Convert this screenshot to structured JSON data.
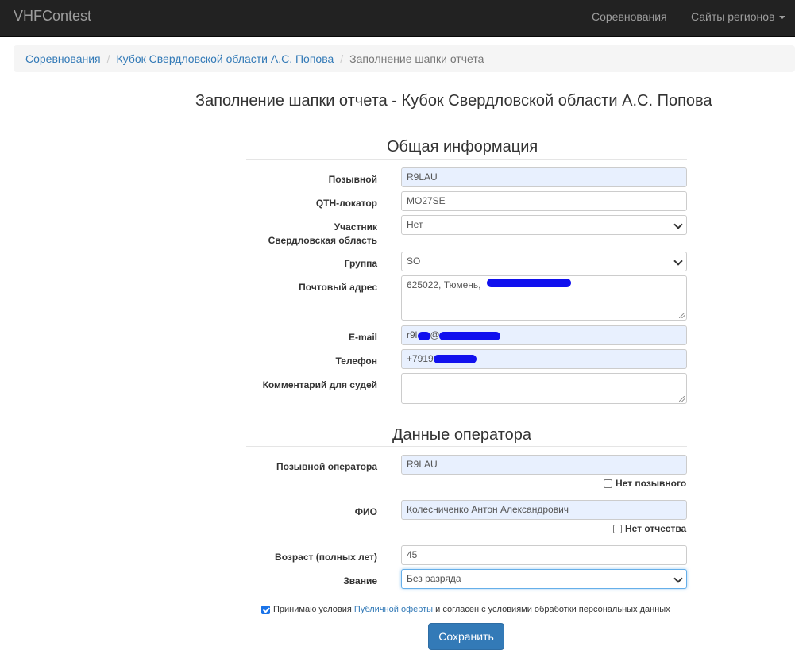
{
  "navbar": {
    "brand": "VHFContest",
    "competitions": "Соревнования",
    "region_sites": "Сайты регионов"
  },
  "breadcrumb": {
    "items": [
      "Соревнования",
      "Кубок Свердловской области А.С. Попова"
    ],
    "active": "Заполнение шапки отчета"
  },
  "page_title": "Заполнение шапки отчета - Кубок Свердловской области А.С. Попова",
  "general": {
    "title": "Общая информация",
    "callsign": {
      "label": "Позывной",
      "value": "R9LAU"
    },
    "qth": {
      "label": "QTH-локатор",
      "value": "MO27SE"
    },
    "participant": {
      "label": "Участник",
      "label2": "Свердловская область",
      "value": "Нет"
    },
    "group": {
      "label": "Группа",
      "value": "SO"
    },
    "address": {
      "label": "Почтовый адрес",
      "value": "625022, Тюмень,"
    },
    "email": {
      "label": "E-mail",
      "value": "r9l",
      "value2": "@"
    },
    "phone": {
      "label": "Телефон",
      "value": "+7919"
    },
    "comment": {
      "label": "Комментарий для судей",
      "value": ""
    }
  },
  "operator": {
    "title": "Данные оператора",
    "callsign": {
      "label": "Позывной оператора",
      "value": "R9LAU",
      "no_callsign": "Нет позывного"
    },
    "fio": {
      "label": "ФИО",
      "value": "Колесниченко Антон Александрович",
      "no_patronymic": "Нет отчества"
    },
    "age": {
      "label": "Возраст (полных лет)",
      "value": "45"
    },
    "rank": {
      "label": "Звание",
      "value": "Без разряда"
    }
  },
  "terms": {
    "before": "Принимаю условия",
    "link": "Публичной оферты",
    "after": "и согласен с условиями обработки персональных данных",
    "checked": true
  },
  "save_label": "Сохранить"
}
